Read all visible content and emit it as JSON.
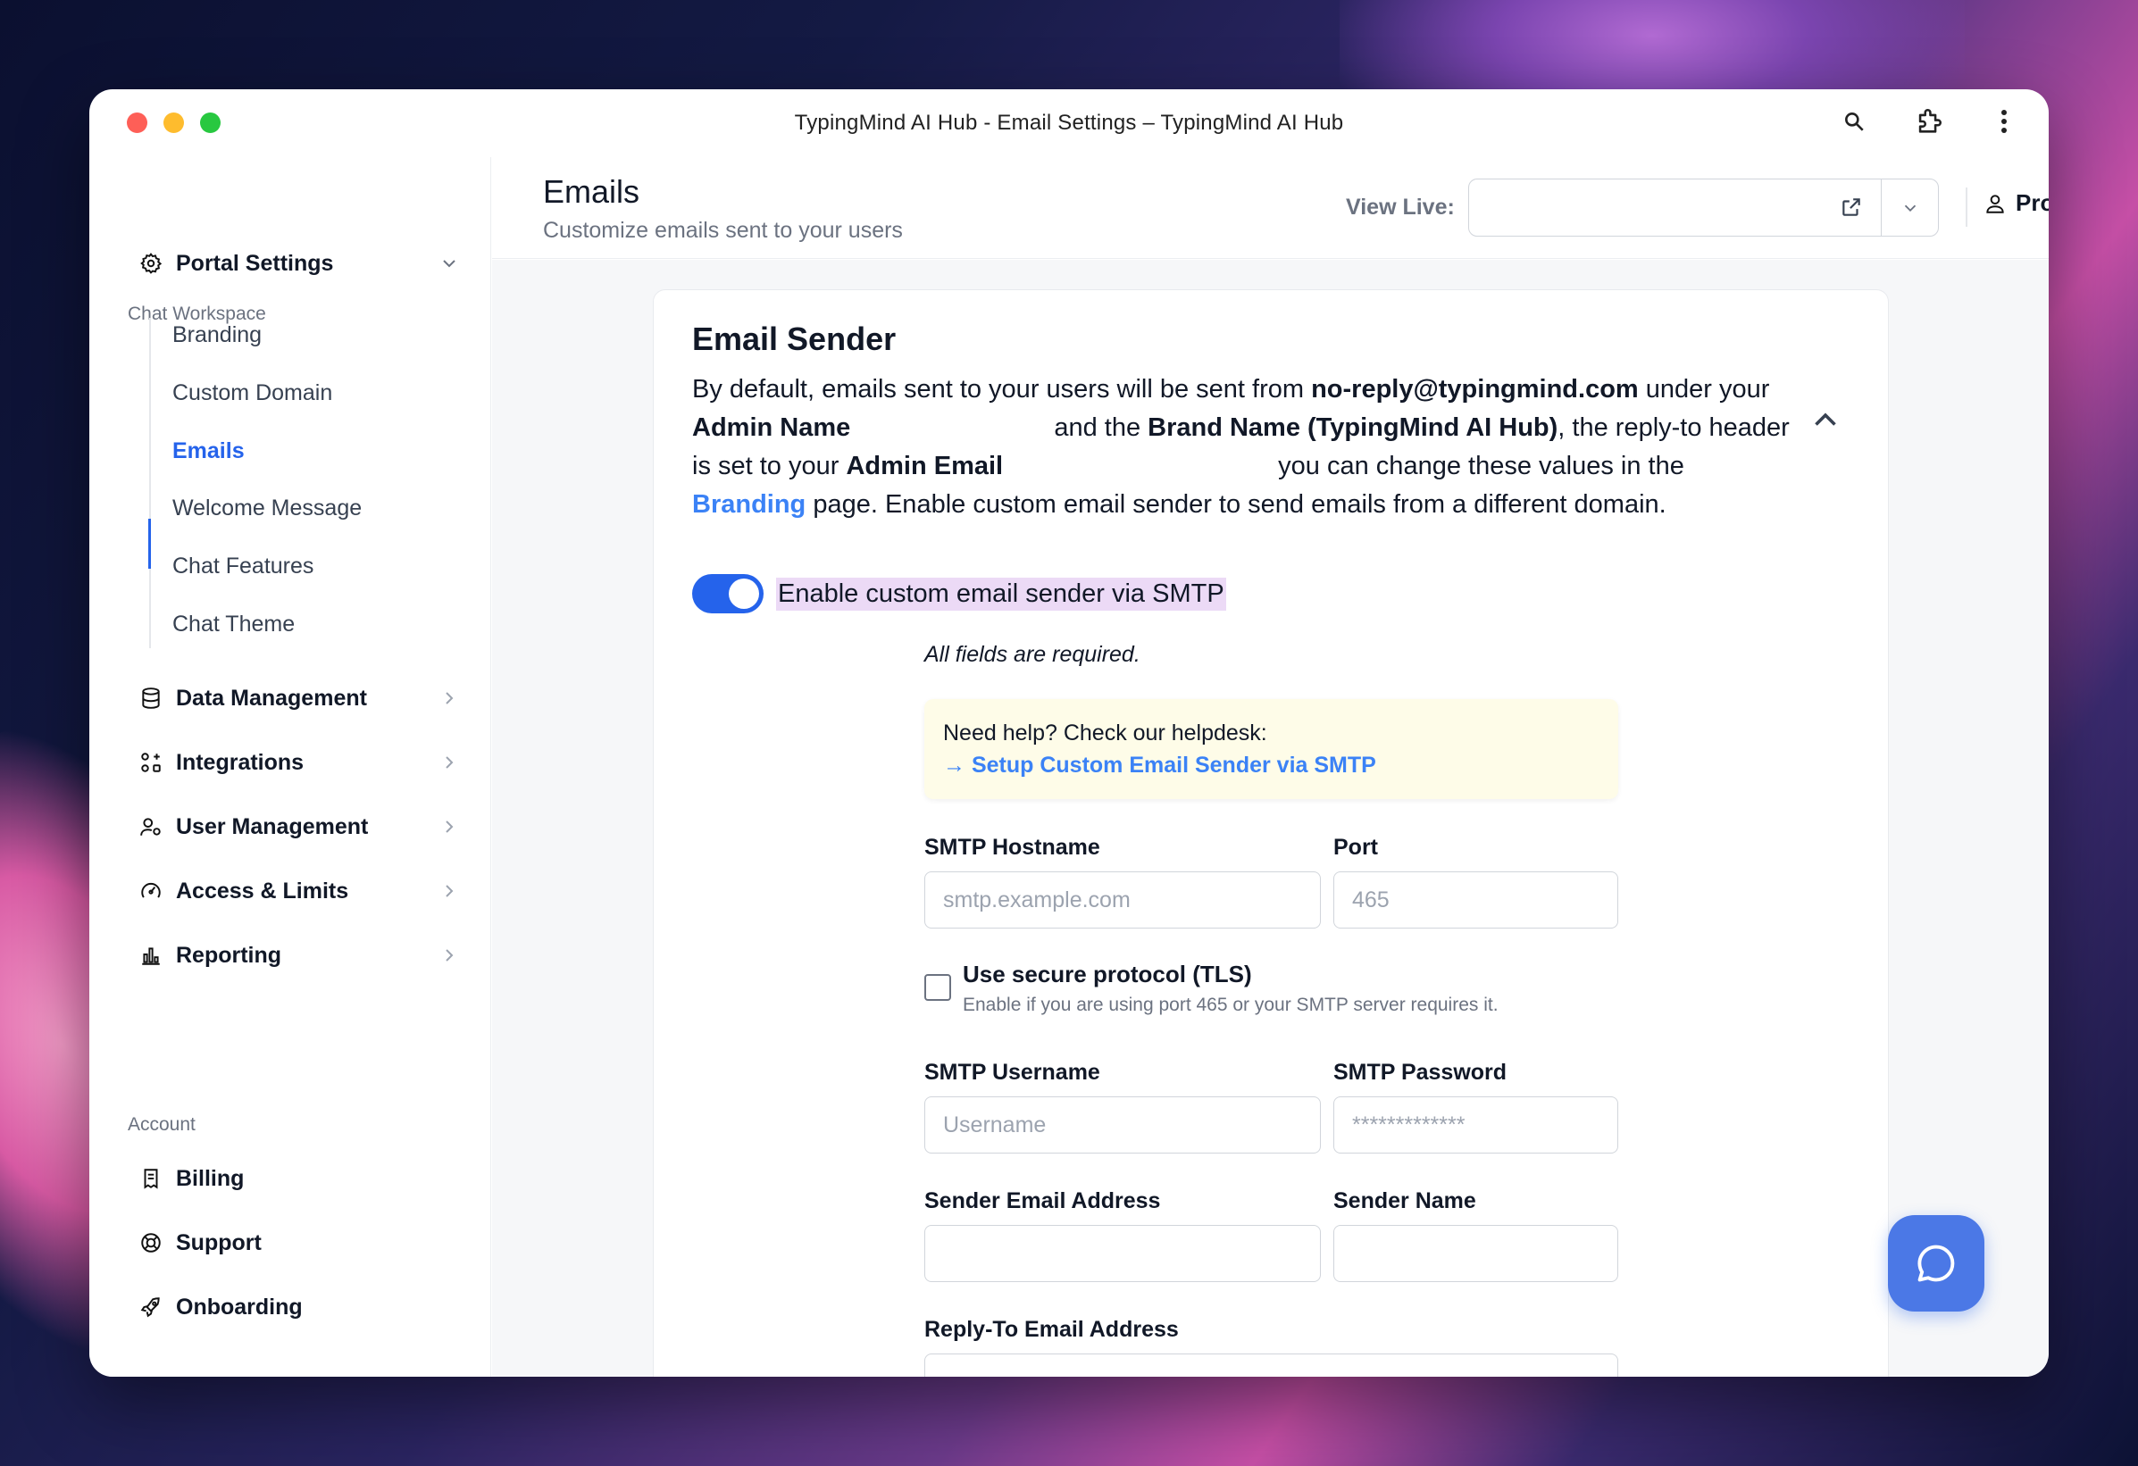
{
  "window": {
    "title": "TypingMind AI Hub - Email Settings – TypingMind AI Hub"
  },
  "sidebar": {
    "section_workspace": "Chat Workspace",
    "portal_settings": "Portal Settings",
    "sub_items": [
      "Branding",
      "Custom Domain",
      "Emails",
      "Welcome Message",
      "Chat Features",
      "Chat Theme"
    ],
    "data_management": "Data Management",
    "integrations": "Integrations",
    "user_management": "User Management",
    "access_limits": "Access & Limits",
    "reporting": "Reporting",
    "section_account": "Account",
    "billing": "Billing",
    "support": "Support",
    "onboarding": "Onboarding"
  },
  "header": {
    "title": "Emails",
    "subtitle": "Customize emails sent to your users",
    "view_live_label": "View Live:",
    "view_live_value": "",
    "profile": "Profile"
  },
  "card": {
    "title": "Email Sender",
    "desc": {
      "p1": "By default, emails sent to your users will be sent from ",
      "email": "no-reply@typingmind.com",
      "p2": " under your ",
      "admin_name": "Admin Name",
      "p3": " and the ",
      "brand_name": "Brand Name (TypingMind AI Hub)",
      "p4": ", the reply-to header is set to your ",
      "admin_email": "Admin Email",
      "p5": " you can change these values in the ",
      "branding_link": "Branding",
      "p6": " page. Enable custom email sender to send emails from a different domain."
    },
    "toggle_label": "Enable custom email sender via SMTP",
    "toggle_on": true,
    "all_required": "All fields are required.",
    "help": {
      "text": "Need help? Check our helpdesk:",
      "link": "→ Setup Custom Email Sender via SMTP"
    },
    "fields": {
      "smtp_hostname_label": "SMTP Hostname",
      "smtp_hostname_placeholder": "smtp.example.com",
      "port_label": "Port",
      "port_placeholder": "465",
      "tls_label": "Use secure protocol (TLS)",
      "tls_desc": "Enable if you are using port 465 or your SMTP server requires it.",
      "tls_checked": false,
      "smtp_username_label": "SMTP Username",
      "smtp_username_placeholder": "Username",
      "smtp_password_label": "SMTP Password",
      "smtp_password_placeholder": "*************",
      "sender_email_label": "Sender Email Address",
      "sender_name_label": "Sender Name",
      "reply_to_label": "Reply-To Email Address"
    }
  },
  "colors": {
    "accent": "#2563eb",
    "link": "#3b82f6",
    "help_bg": "#fefce8",
    "highlight": "#ecdaf6"
  }
}
